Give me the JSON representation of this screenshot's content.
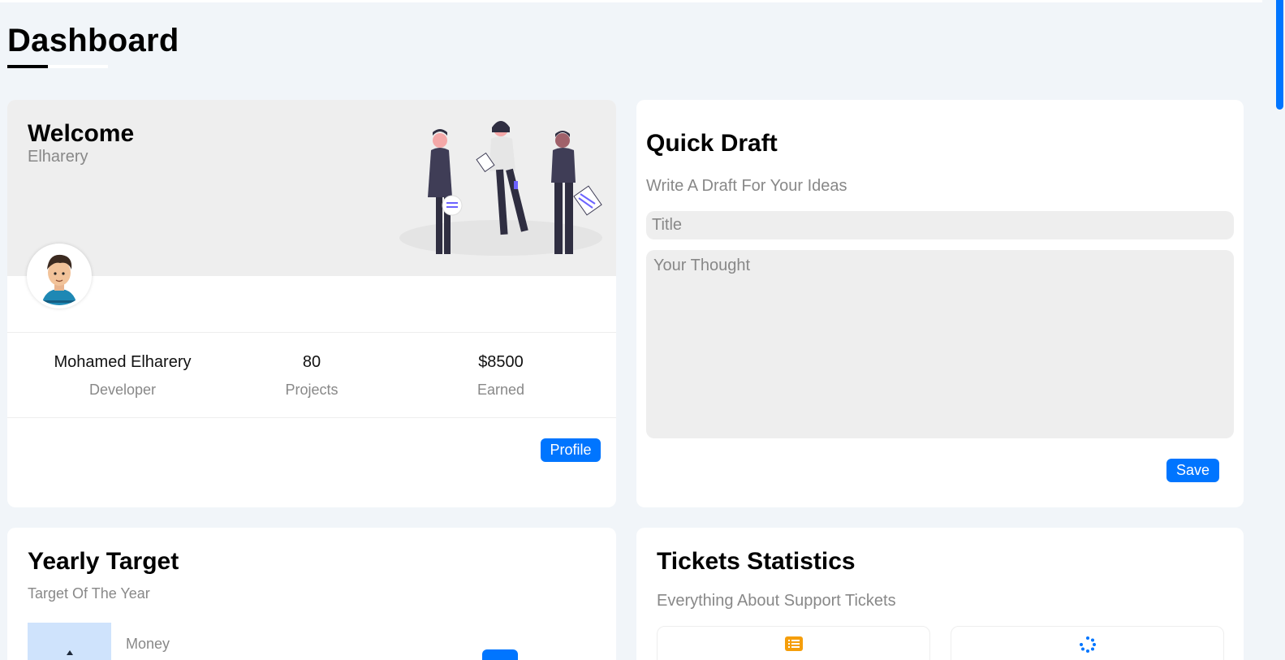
{
  "page": {
    "title": "Dashboard"
  },
  "welcome": {
    "heading": "Welcome",
    "name": "Elharery",
    "stats": [
      {
        "value": "Mohamed Elharery",
        "label": "Developer"
      },
      {
        "value": "80",
        "label": "Projects"
      },
      {
        "value": "$8500",
        "label": "Earned"
      }
    ],
    "profile_button": "Profile"
  },
  "draft": {
    "heading": "Quick Draft",
    "subtitle": "Write A Draft For Your Ideas",
    "title_placeholder": "Title",
    "thought_placeholder": "Your Thought",
    "save_button": "Save"
  },
  "yearly": {
    "heading": "Yearly Target",
    "subtitle": "Target Of The Year",
    "items": [
      {
        "label": "Money"
      }
    ]
  },
  "tickets": {
    "heading": "Tickets Statistics",
    "subtitle": "Everything About Support Tickets",
    "boxes": [
      {
        "icon": "list-icon",
        "color": "#f59e0b"
      },
      {
        "icon": "spinner-icon",
        "color": "#0075ff"
      }
    ]
  },
  "colors": {
    "accent": "#0075ff",
    "background": "#f1f5f9"
  }
}
